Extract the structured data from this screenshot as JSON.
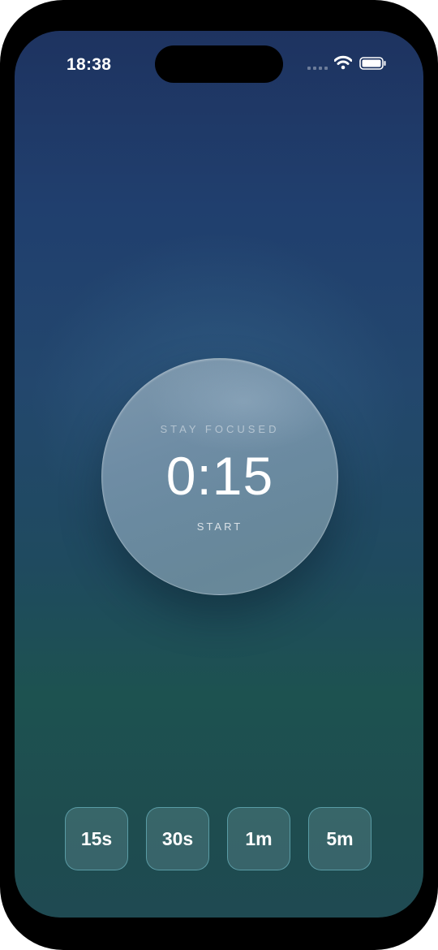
{
  "status_bar": {
    "time": "18:38",
    "icons": [
      "signal-dots-icon",
      "wifi-icon",
      "battery-icon"
    ]
  },
  "timer": {
    "caption": "STAY FOCUSED",
    "time": "0:15",
    "action_label": "START"
  },
  "presets": [
    {
      "label": "15s"
    },
    {
      "label": "30s"
    },
    {
      "label": "1m"
    },
    {
      "label": "5m"
    }
  ],
  "colors": {
    "background_top": "#1e3360",
    "background_bottom": "#1f4a52",
    "circle": "#6f8da5",
    "preset_border": "#78c8d7",
    "text": "#ffffff"
  }
}
